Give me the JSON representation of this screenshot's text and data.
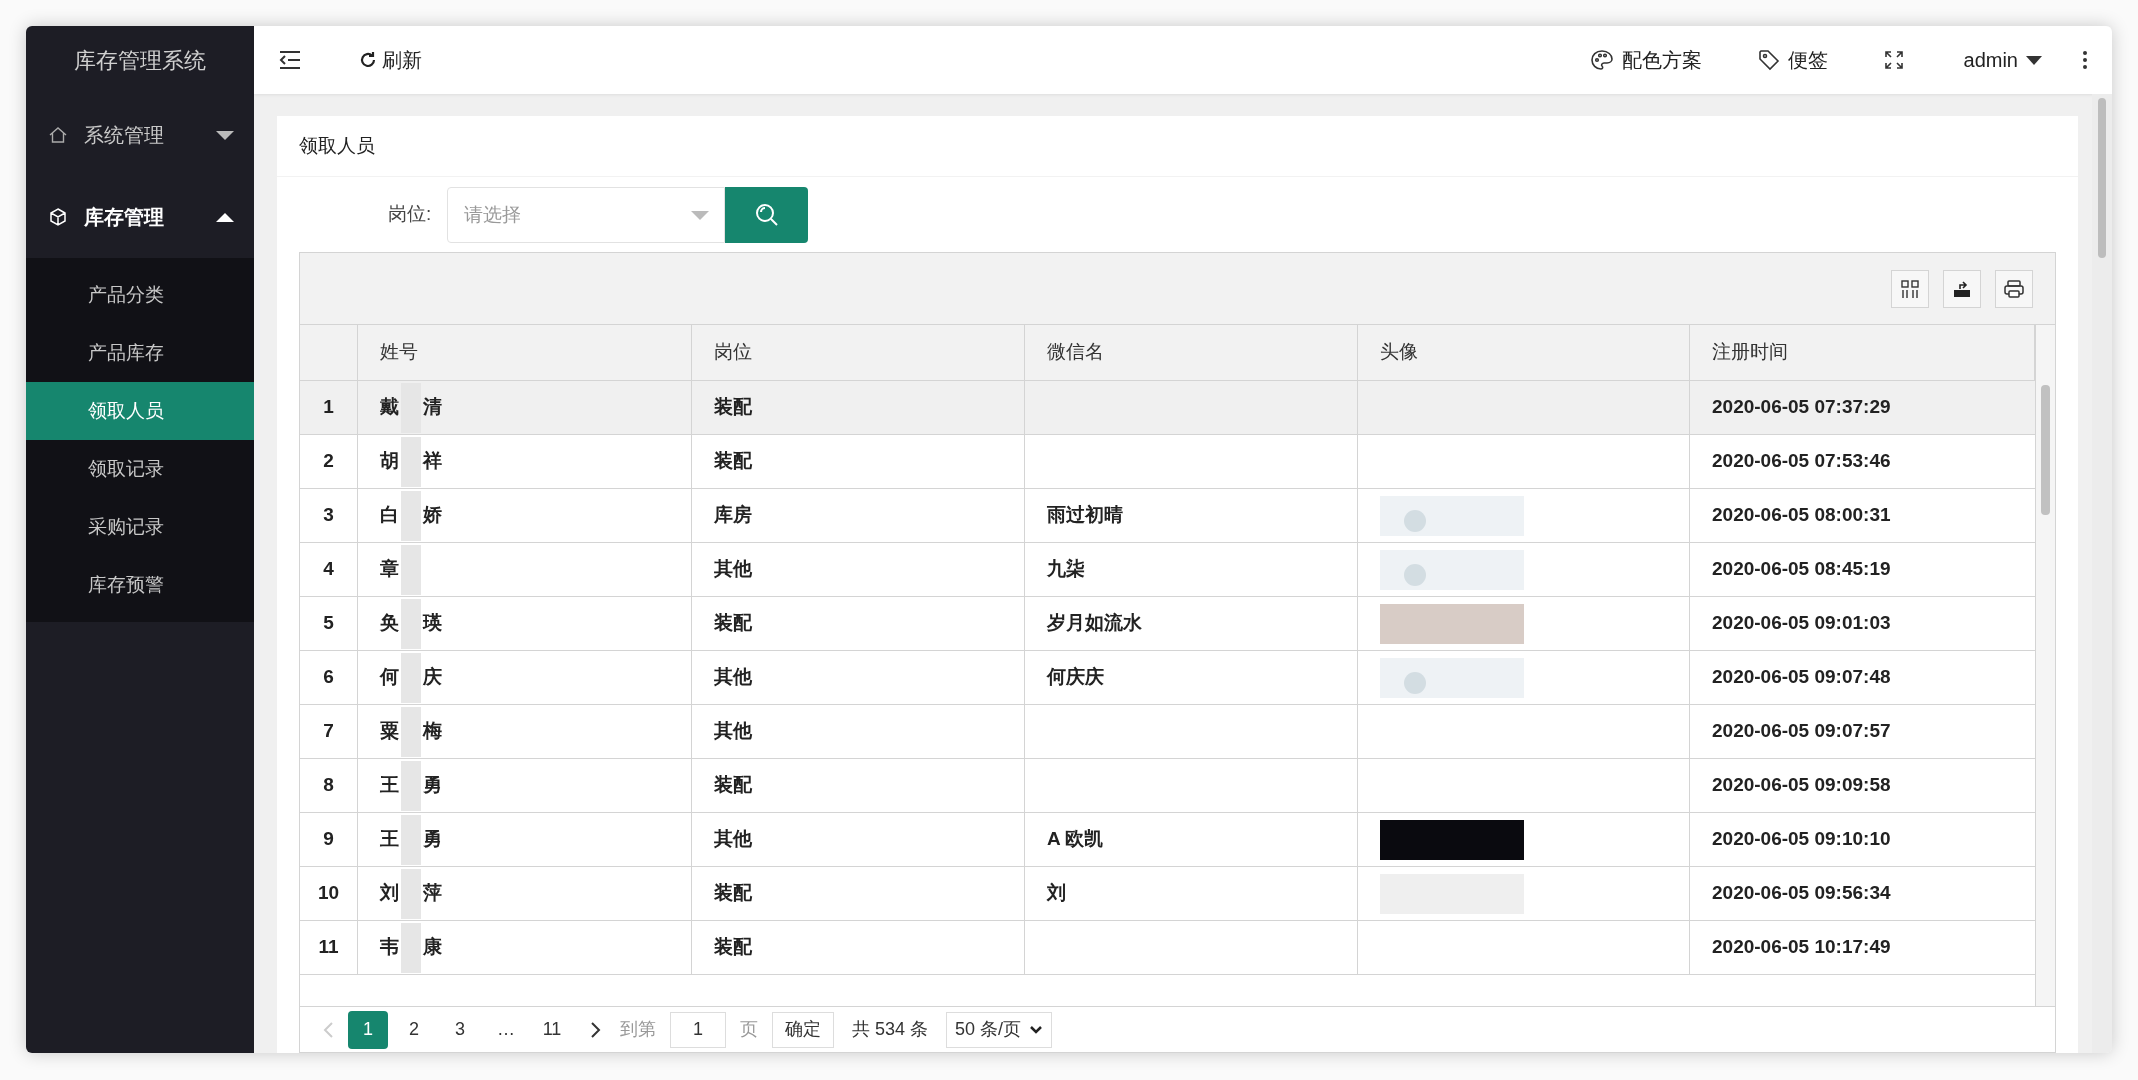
{
  "sidebar": {
    "title": "库存管理系统",
    "groups": [
      {
        "label": "系统管理",
        "expanded": false
      },
      {
        "label": "库存管理",
        "expanded": true,
        "items": [
          {
            "label": "产品分类",
            "selected": false
          },
          {
            "label": "产品库存",
            "selected": false
          },
          {
            "label": "领取人员",
            "selected": true
          },
          {
            "label": "领取记录",
            "selected": false
          },
          {
            "label": "采购记录",
            "selected": false
          },
          {
            "label": "库存预警",
            "selected": false
          }
        ]
      }
    ]
  },
  "topbar": {
    "refresh": "刷新",
    "theme": "配色方案",
    "notes": "便签",
    "user": "admin"
  },
  "card": {
    "title": "领取人员",
    "filter": {
      "label": "岗位:",
      "placeholder": "请选择"
    },
    "table": {
      "columns": [
        "姓号",
        "岗位",
        "微信名",
        "头像",
        "注册时间"
      ],
      "rows": [
        {
          "index": "1",
          "name_start": "戴",
          "name_end": "清",
          "post": "装配",
          "time": "2020-06-05 07:37:29",
          "selected": true
        },
        {
          "index": "2",
          "name_start": "胡",
          "name_end": "祥",
          "post": "装配",
          "time": "2020-06-05 07:53:46",
          "selected": false
        },
        {
          "index": "3",
          "name_start": "白",
          "name_end": "娇",
          "post": "库房",
          "wechat": "雨过初晴",
          "avatar": {
            "kind": "default"
          },
          "time": "2020-06-05 08:00:31",
          "selected": false
        },
        {
          "index": "4",
          "name_start": "章",
          "post": "其他",
          "wechat": "九柒",
          "avatar": {
            "kind": "default"
          },
          "time": "2020-06-05 08:45:19",
          "selected": false
        },
        {
          "index": "5",
          "name_start": "奂",
          "name_end": "瑛",
          "post": "装配",
          "wechat": "岁月如流水",
          "avatar": {
            "kind": "light"
          },
          "time": "2020-06-05 09:01:03",
          "selected": false
        },
        {
          "index": "6",
          "name_start": "何",
          "name_end": "庆",
          "post": "其他",
          "wechat": "何庆庆",
          "avatar": {
            "kind": "default"
          },
          "time": "2020-06-05 09:07:48",
          "selected": false
        },
        {
          "index": "7",
          "name_start": "粟",
          "name_end": "梅",
          "post": "其他",
          "time": "2020-06-05 09:07:57",
          "selected": false
        },
        {
          "index": "8",
          "name_start": "王",
          "name_end": "勇",
          "post": "装配",
          "time": "2020-06-05 09:09:58",
          "selected": false
        },
        {
          "index": "9",
          "name_start": "王",
          "name_end": "勇",
          "post": "其他",
          "wechat": "A 欧凯",
          "avatar": {
            "kind": "dark"
          },
          "time": "2020-06-05 09:10:10",
          "selected": false
        },
        {
          "index": "10",
          "name_start": "刘",
          "name_end": "萍",
          "post": "装配",
          "wechat": "刘",
          "avatar": {
            "kind": "grey"
          },
          "time": "2020-06-05 09:56:34",
          "selected": false
        },
        {
          "index": "11",
          "name_start": "韦",
          "name_end": "康",
          "post": "装配",
          "time": "2020-06-05 10:17:49",
          "selected": false
        }
      ]
    },
    "pagination": {
      "pages": [
        {
          "label": "1",
          "selected": true
        },
        {
          "label": "2",
          "selected": false
        },
        {
          "label": "3",
          "selected": false
        },
        {
          "label": "…",
          "selected": false
        },
        {
          "label": "11",
          "selected": false
        }
      ],
      "goto": "到第",
      "page_value": "1",
      "page_unit": "页",
      "confirm": "确定",
      "total": "共 534 条",
      "page_size": "50 条/页"
    }
  }
}
